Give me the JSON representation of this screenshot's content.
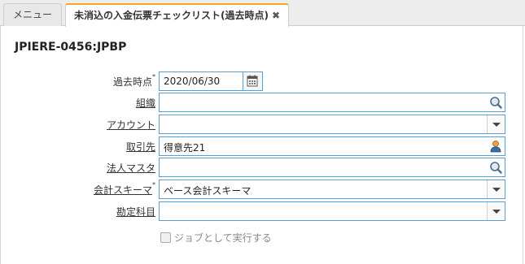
{
  "tabs": {
    "menu_label": "メニュー",
    "active_label": "未消込の入金伝票チェックリスト(過去時点)",
    "close_glyph": "✖"
  },
  "window": {
    "title": "JPIERE-0456:JPBP"
  },
  "form": {
    "date_label": "過去時点",
    "date_value": "2020/06/30",
    "org_label": "組織",
    "org_value": "",
    "account_label": "アカウント",
    "account_value": "",
    "bp_label": "取引先",
    "bp_value": "得意先21",
    "corp_label": "法人マスタ",
    "corp_value": "",
    "schema_label": "会計スキーマ",
    "schema_value": "ベース会計スキーマ",
    "element_label": "勘定科目",
    "element_value": "",
    "required_mark": "*"
  },
  "options": {
    "batch_label": "ジョブとして実行する"
  },
  "colors": {
    "accent": "#f5a623",
    "field_border": "#5a9fd4"
  },
  "icons": [
    "calendar-icon",
    "search-icon",
    "chevron-down-icon",
    "person-icon"
  ]
}
